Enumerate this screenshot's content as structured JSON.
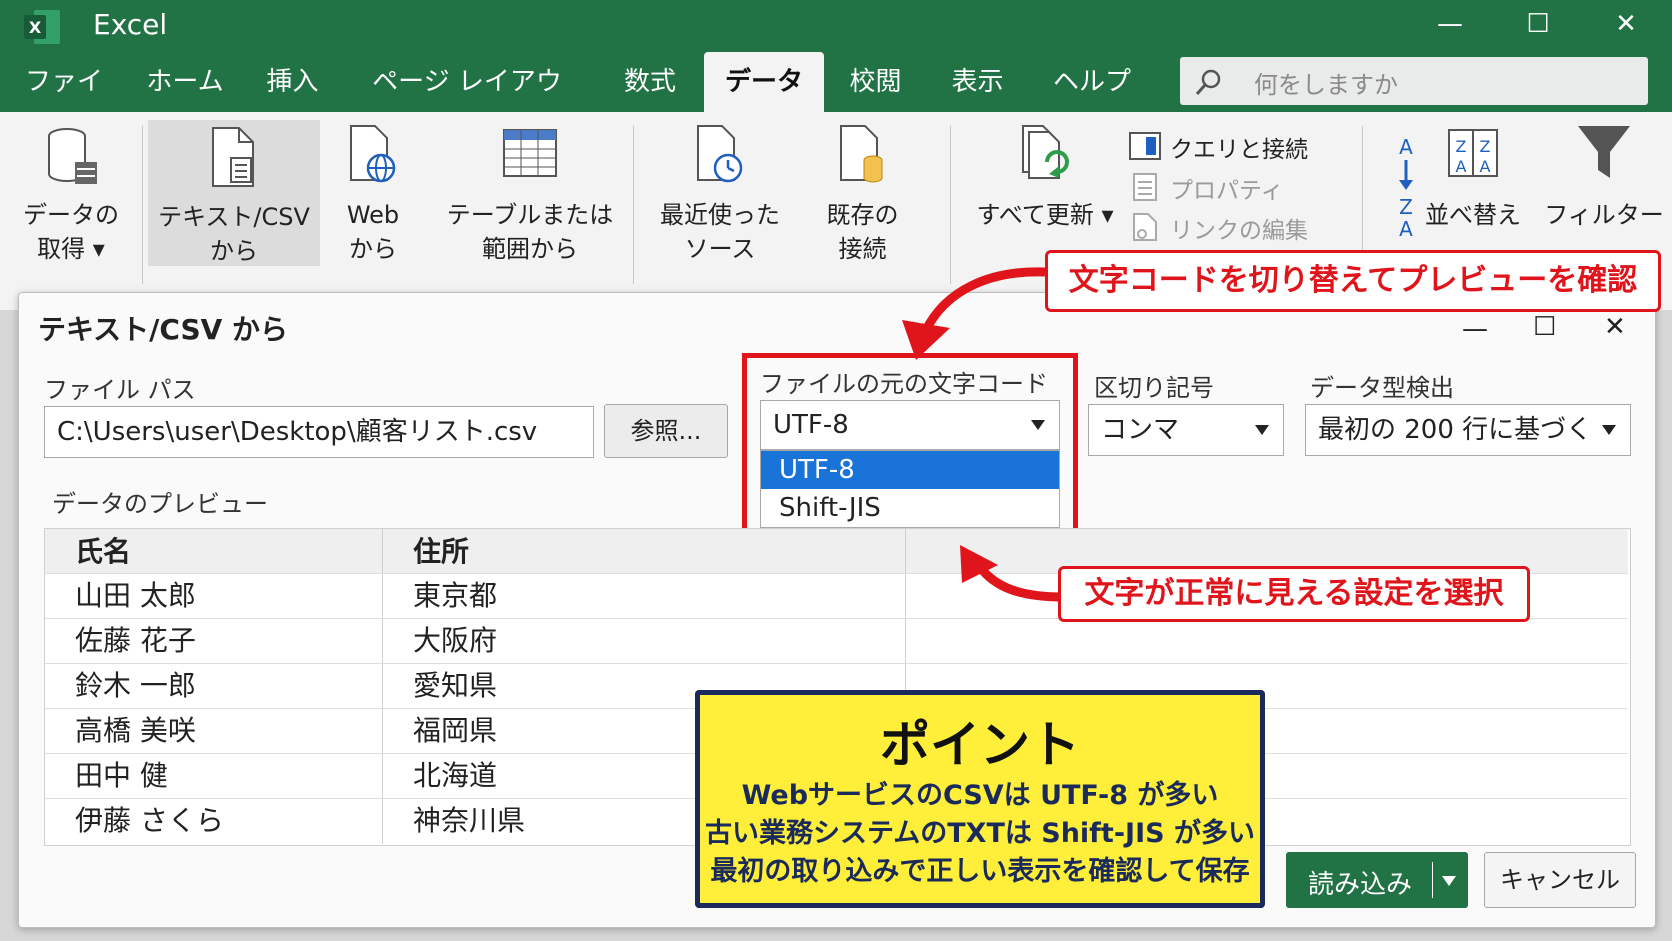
{
  "app": {
    "title": "Excel",
    "logo_letter": "X"
  },
  "window_controls": {
    "minimize": "—",
    "maximize": "☐",
    "close": "✕"
  },
  "menu": {
    "tabs": [
      "ファイル",
      "ホーム",
      "挿入",
      "ページ レイアウト",
      "数式",
      "データ",
      "校閲",
      "表示",
      "ヘルプ"
    ],
    "active": "データ"
  },
  "search": {
    "placeholder": "何をしますか"
  },
  "ribbon": {
    "get_data": [
      "データの",
      "取得 ▾"
    ],
    "text_csv": [
      "テキスト/CSV",
      "から"
    ],
    "web": [
      "Web",
      "から"
    ],
    "table_range": [
      "テーブルまたは",
      "範囲から"
    ],
    "recent": [
      "最近使った",
      "ソース"
    ],
    "existing": [
      "既存の",
      "接続"
    ],
    "refresh_all": "すべて更新 ▾",
    "queries": "クエリと接続",
    "properties": "プロパティ",
    "edit_links": "リンクの編集",
    "sort": "並べ替え",
    "filter": "フィルター"
  },
  "dialog": {
    "title": "テキスト/CSV から",
    "file_path_label": "ファイル パス",
    "file_path_value": "C:\\Users\\user\\Desktop\\顧客リスト.csv",
    "browse_button": "参照...",
    "encoding_label": "ファイルの元の文字コード",
    "encoding_value": "UTF-8",
    "encoding_options": [
      "UTF-8",
      "Shift-JIS"
    ],
    "delimiter_label": "区切り記号",
    "delimiter_value": "コンマ",
    "type_detect_label": "データ型検出",
    "type_detect_value": "最初の 200 行に基づく",
    "preview_label": "データのプレビュー",
    "table": {
      "headers": [
        "氏名",
        "住所"
      ],
      "rows": [
        [
          "山田 太郎",
          "東京都"
        ],
        [
          "佐藤 花子",
          "大阪府"
        ],
        [
          "鈴木 一郎",
          "愛知県"
        ],
        [
          "高橋 美咲",
          "福岡県"
        ],
        [
          "田中 健",
          "北海道"
        ],
        [
          "伊藤 さくら",
          "神奈川県"
        ]
      ]
    },
    "load_button": "読み込み",
    "cancel_button": "キャンセル"
  },
  "annotations": {
    "top_callout": "文字コードを切り替えてプレビューを確認",
    "bottom_callout": "文字が正常に見える設定を選択",
    "point_title": "ポイント",
    "point_lines": [
      "WebサービスのCSVは UTF-8 が多い",
      "古い業務システムのTXTは Shift-JIS が多い",
      "最初の取り込みで正しい表示を確認して保存"
    ]
  },
  "colors": {
    "excel_green": "#217346",
    "highlight_blue": "#1a73d9",
    "annotation_red": "#e0141b",
    "point_yellow": "#ffef3a"
  }
}
